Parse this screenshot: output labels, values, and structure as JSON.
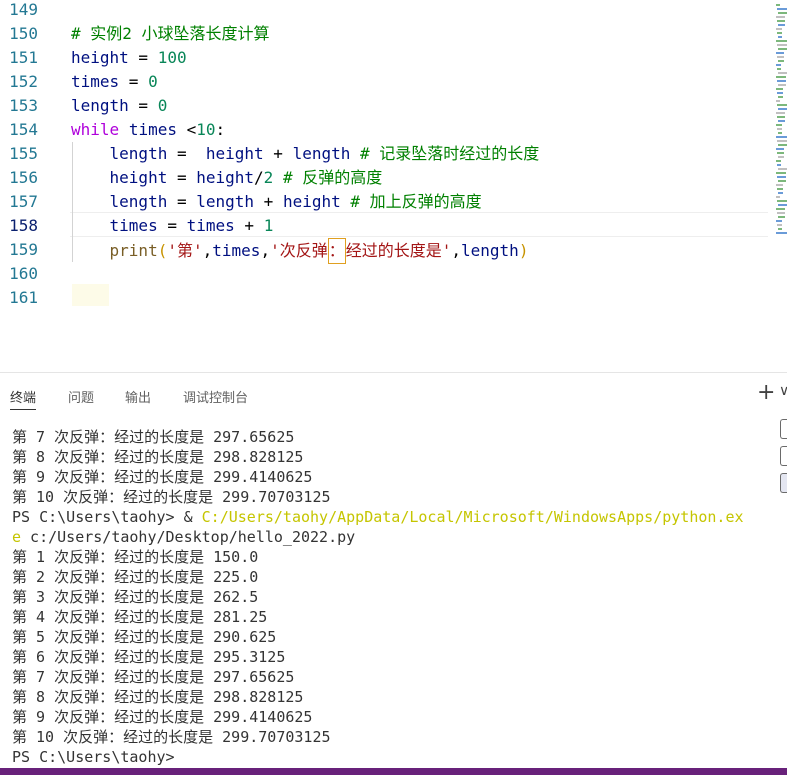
{
  "editor": {
    "lines": [
      {
        "no": "149",
        "tokens": []
      },
      {
        "no": "150",
        "tokens": [
          {
            "t": "cm",
            "v": "# 实例2 小球坠落长度计算"
          }
        ]
      },
      {
        "no": "151",
        "tokens": [
          {
            "t": "var",
            "v": "height"
          },
          {
            "t": "op",
            "v": " = "
          },
          {
            "t": "num",
            "v": "100"
          }
        ]
      },
      {
        "no": "152",
        "tokens": [
          {
            "t": "var",
            "v": "times"
          },
          {
            "t": "op",
            "v": " = "
          },
          {
            "t": "num",
            "v": "0"
          }
        ]
      },
      {
        "no": "153",
        "tokens": [
          {
            "t": "var",
            "v": "length"
          },
          {
            "t": "op",
            "v": " = "
          },
          {
            "t": "num",
            "v": "0"
          }
        ]
      },
      {
        "no": "154",
        "tokens": [
          {
            "t": "kw",
            "v": "while"
          },
          {
            "t": "op",
            "v": " "
          },
          {
            "t": "var",
            "v": "times"
          },
          {
            "t": "op",
            "v": " <"
          },
          {
            "t": "num",
            "v": "10"
          },
          {
            "t": "op",
            "v": ":"
          }
        ]
      },
      {
        "no": "155",
        "tokens": [
          {
            "t": "op",
            "v": "    "
          },
          {
            "t": "var",
            "v": "length"
          },
          {
            "t": "op",
            "v": " =  "
          },
          {
            "t": "var",
            "v": "height"
          },
          {
            "t": "op",
            "v": " + "
          },
          {
            "t": "var",
            "v": "length"
          },
          {
            "t": "op",
            "v": " "
          },
          {
            "t": "cm",
            "v": "# 记录坠落时经过的长度"
          }
        ]
      },
      {
        "no": "156",
        "tokens": [
          {
            "t": "op",
            "v": "    "
          },
          {
            "t": "var",
            "v": "height"
          },
          {
            "t": "op",
            "v": " = "
          },
          {
            "t": "var",
            "v": "height"
          },
          {
            "t": "op",
            "v": "/"
          },
          {
            "t": "num",
            "v": "2"
          },
          {
            "t": "op",
            "v": " "
          },
          {
            "t": "cm",
            "v": "# 反弹的高度"
          }
        ]
      },
      {
        "no": "157",
        "tokens": [
          {
            "t": "op",
            "v": "    "
          },
          {
            "t": "var",
            "v": "length"
          },
          {
            "t": "op",
            "v": " = "
          },
          {
            "t": "var",
            "v": "length"
          },
          {
            "t": "op",
            "v": " + "
          },
          {
            "t": "var",
            "v": "height"
          },
          {
            "t": "op",
            "v": " "
          },
          {
            "t": "cm",
            "v": "# 加上反弹的高度"
          }
        ]
      },
      {
        "no": "158",
        "tokens": [
          {
            "t": "op",
            "v": "    "
          },
          {
            "t": "var",
            "v": "times"
          },
          {
            "t": "op",
            "v": " = "
          },
          {
            "t": "var",
            "v": "times"
          },
          {
            "t": "op",
            "v": " + "
          },
          {
            "t": "num",
            "v": "1"
          }
        ]
      },
      {
        "no": "159",
        "tokens": [
          {
            "t": "op",
            "v": "    "
          },
          {
            "t": "fn",
            "v": "print"
          },
          {
            "t": "br",
            "v": "("
          },
          {
            "t": "str",
            "v": "'第'"
          },
          {
            "t": "op",
            "v": ","
          },
          {
            "t": "var",
            "v": "times"
          },
          {
            "t": "op",
            "v": ","
          },
          {
            "t": "str",
            "v": "'次反弹"
          },
          {
            "t": "cursor",
            "v": "："
          },
          {
            "t": "str",
            "v": "经过的长度是'"
          },
          {
            "t": "op",
            "v": ","
          },
          {
            "t": "var",
            "v": "length"
          },
          {
            "t": "br",
            "v": ")"
          }
        ]
      },
      {
        "no": "160",
        "tokens": []
      },
      {
        "no": "161",
        "tokens": []
      }
    ],
    "active_line": "158"
  },
  "panel": {
    "tabs": [
      {
        "label": "终端",
        "active": true
      },
      {
        "label": "问题",
        "active": false
      },
      {
        "label": "输出",
        "active": false
      },
      {
        "label": "调试控制台",
        "active": false
      }
    ],
    "new_terminal_icon": "+",
    "more_icon": "∨"
  },
  "terminal": {
    "lines": [
      [
        {
          "t": "n",
          "v": "第 7 次反弹：经过的长度是 297.65625"
        }
      ],
      [
        {
          "t": "n",
          "v": "第 8 次反弹：经过的长度是 298.828125"
        }
      ],
      [
        {
          "t": "n",
          "v": "第 9 次反弹：经过的长度是 299.4140625"
        }
      ],
      [
        {
          "t": "n",
          "v": "第 10 次反弹：经过的长度是 299.70703125"
        }
      ],
      [
        {
          "t": "n",
          "v": "PS C:\\Users\\taohy> & "
        },
        {
          "t": "p",
          "v": "C:/Users/taohy/AppData/Local/Microsoft/WindowsApps/python.ex"
        }
      ],
      [
        {
          "t": "p",
          "v": "e"
        },
        {
          "t": "n",
          "v": " c:/Users/taohy/Desktop/hello_2022.py"
        }
      ],
      [
        {
          "t": "n",
          "v": "第 1 次反弹：经过的长度是 150.0"
        }
      ],
      [
        {
          "t": "n",
          "v": "第 2 次反弹：经过的长度是 225.0"
        }
      ],
      [
        {
          "t": "n",
          "v": "第 3 次反弹：经过的长度是 262.5"
        }
      ],
      [
        {
          "t": "n",
          "v": "第 4 次反弹：经过的长度是 281.25"
        }
      ],
      [
        {
          "t": "n",
          "v": "第 5 次反弹：经过的长度是 290.625"
        }
      ],
      [
        {
          "t": "n",
          "v": "第 6 次反弹：经过的长度是 295.3125"
        }
      ],
      [
        {
          "t": "n",
          "v": "第 7 次反弹：经过的长度是 297.65625"
        }
      ],
      [
        {
          "t": "n",
          "v": "第 8 次反弹：经过的长度是 298.828125"
        }
      ],
      [
        {
          "t": "n",
          "v": "第 9 次反弹：经过的长度是 299.4140625"
        }
      ],
      [
        {
          "t": "n",
          "v": "第 10 次反弹：经过的长度是 299.70703125"
        }
      ],
      [
        {
          "t": "n",
          "v": "PS C:\\Users\\taohy>"
        }
      ]
    ]
  },
  "colors": {
    "line_number": "#237893",
    "keyword": "#af00db",
    "number": "#098658",
    "comment": "#008000",
    "string": "#a31515",
    "function": "#795e26",
    "path_highlight": "#c5c500",
    "status_bar": "#68217a"
  }
}
